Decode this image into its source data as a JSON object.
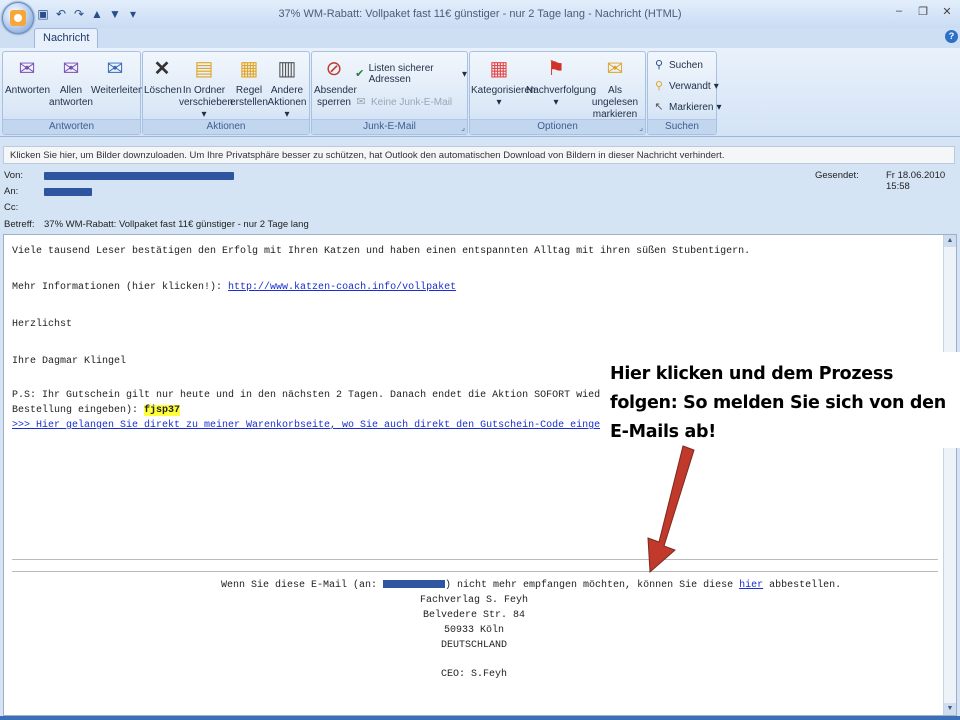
{
  "window": {
    "title": "37% WM-Rabatt: Vollpaket fast 11€ günstiger - nur 2 Tage lang - Nachricht (HTML)"
  },
  "tabs": [
    {
      "label": "Nachricht"
    }
  ],
  "ribbon": {
    "groups": [
      {
        "label": "Antworten",
        "buttons": [
          "Antworten",
          "Allen antworten",
          "Weiterleiten"
        ]
      },
      {
        "label": "Aktionen",
        "buttons": [
          "Löschen",
          "In Ordner verschieben",
          "Regel erstellen",
          "Andere Aktionen"
        ]
      },
      {
        "label": "Junk-E-Mail",
        "buttons": [
          "Absender sperren",
          "Listen sicherer Adressen",
          "Keine Junk-E-Mail"
        ]
      },
      {
        "label": "Optionen",
        "buttons": [
          "Kategorisieren",
          "Nachverfolgung",
          "Als ungelesen markieren"
        ]
      },
      {
        "label": "Suchen",
        "buttons": [
          "Suchen",
          "Verwandt",
          "Markieren"
        ]
      }
    ]
  },
  "infobar": {
    "text": "Klicken Sie hier, um Bilder downzuloaden. Um Ihre Privatsphäre besser zu schützen, hat Outlook den automatischen Download von Bildern in dieser Nachricht verhindert."
  },
  "header": {
    "from_label": "Von:",
    "to_label": "An:",
    "cc_label": "Cc:",
    "subject_label": "Betreff:",
    "subject": "37% WM-Rabatt: Vollpaket fast 11€ günstiger - nur 2 Tage lang",
    "sent_label": "Gesendet:",
    "sent": "Fr 18.06.2010 15:58"
  },
  "message": {
    "line1": "Viele tausend Leser bestätigen den Erfolg mit Ihren Katzen und haben einen entspannten Alltag mit ihren süßen Stubentigern.",
    "more_info_prefix": "Mehr Informationen (hier klicken!): ",
    "more_info_link": "http://www.katzen-coach.info/vollpaket",
    "greeting": "Herzlichst",
    "signature": "Ihre Dagmar Klingel",
    "ps_line1": "P.S: Ihr Gutschein gilt nur heute und in den nächsten 2 Tagen. Danach endet die Aktion SOFORT wieder. Hie",
    "ps_line2_prefix": "Bestellung eingeben): ",
    "coupon_code": "fjsp37",
    "cart_link": ">>> Hier gelangen Sie direkt zu meiner Warenkorbseite, wo Sie auch direkt den Gutschein-Code eingeben kön"
  },
  "footer": {
    "unsubscribe_prefix": "Wenn Sie diese E-Mail (an: ",
    "unsubscribe_middle": ") nicht mehr empfangen möchten, können Sie diese ",
    "unsubscribe_link": "hier",
    "unsubscribe_suffix": " abbestellen.",
    "company": "Fachverlag S. Feyh",
    "street": "Belvedere Str. 84",
    "city": "50933 Köln",
    "country": "DEUTSCHLAND",
    "ceo": "CEO: S.Feyh"
  },
  "annotation": {
    "text": "Hier klicken und dem Prozess folgen: So melden Sie sich von den E-Mails ab!",
    "arrow_color": "#c0392b"
  }
}
